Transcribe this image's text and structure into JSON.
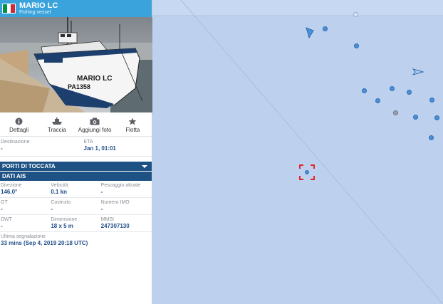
{
  "vessel": {
    "name": "MARIO LC",
    "type": "Fishing vessel",
    "flag_colors": [
      "#009246",
      "#ffffff",
      "#ce2b37"
    ]
  },
  "photo": {
    "name_marking": "MARIO LC",
    "registration_marking": "PA1358"
  },
  "actions": [
    {
      "label": "Dettagli",
      "icon": "info-icon"
    },
    {
      "label": "Traccia",
      "icon": "ship-track-icon"
    },
    {
      "label": "Aggiungi foto",
      "icon": "camera-icon"
    },
    {
      "label": "Flotta",
      "icon": "star-icon"
    }
  ],
  "voyage": {
    "destination_label": "Destinazione",
    "destination_value": "-",
    "eta_label": "ETA",
    "eta_value": "Jan 1, 01:01"
  },
  "sections": {
    "ports": "PORTI DI TOCCATA",
    "ais": "DATI AIS"
  },
  "ais": {
    "heading_label": "Direzione",
    "heading_value": "146.0°",
    "speed_label": "Velocità",
    "speed_value": "0.1 kn",
    "draught_label": "Pescaggio attuale",
    "draught_value": "-",
    "gt_label": "GT",
    "gt_value": "-",
    "built_label": "Costruito",
    "built_value": "-",
    "imo_label": "Numero IMO",
    "imo_value": "-",
    "dwt_label": "DWT",
    "dwt_value": "-",
    "size_label": "Dimensione",
    "size_value": "18 x 5 m",
    "mmsi_label": "MMSI",
    "mmsi_value": "247307130",
    "last_report_label": "Ultima segnalazione",
    "last_report_value": "33 mins (Sep 4, 2019 20:18 UTC)"
  },
  "colors": {
    "header": "#3aa3dc",
    "section_bar": "#1e5285",
    "value_text": "#1f4e8a",
    "map_water": "#bdd1ef",
    "selection": "#e3262b"
  }
}
